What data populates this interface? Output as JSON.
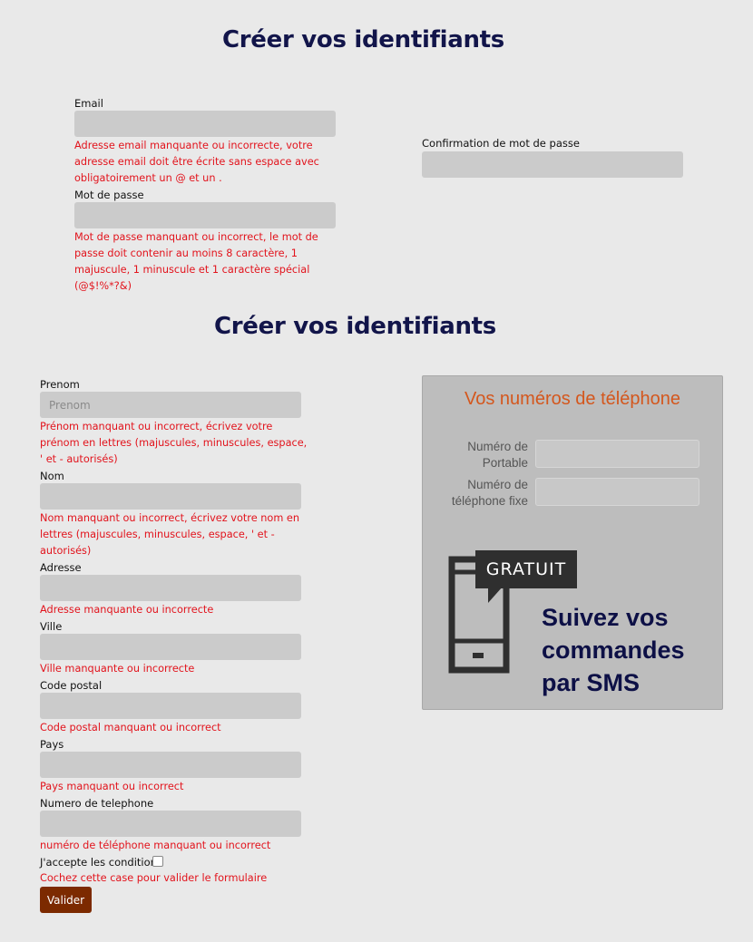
{
  "section1": {
    "title": "Créer vos identifiants",
    "email_label": "Email",
    "email_error": "Adresse email manquante ou incorrecte, votre adresse email doit être écrite sans espace avec obligatoirement un @ et un .",
    "password_label": "Mot de passe",
    "password_error": "Mot de passe manquant ou incorrect, le mot de passe doit contenir au moins 8 caractère, 1 majuscule, 1 minuscule et 1 caractère spécial (@$!%*?&)",
    "confirm_label": "Confirmation de mot de passe"
  },
  "section2": {
    "title": "Créer vos identifiants",
    "prenom_label": "Prenom",
    "prenom_placeholder": "Prenom",
    "prenom_error": "Prénom manquant ou incorrect, écrivez votre prénom en lettres (majuscules, minuscules, espace, ' et - autorisés)",
    "nom_label": "Nom",
    "nom_error": "Nom manquant ou incorrect, écrivez votre nom en lettres (majuscules, minuscules, espace, ' et - autorisés)",
    "adresse_label": "Adresse",
    "adresse_error": "Adresse manquante ou incorrecte",
    "ville_label": "Ville",
    "ville_error": "Ville manquante ou incorrecte",
    "cp_label": "Code postal",
    "cp_error": "Code postal manquant ou incorrect",
    "pays_label": "Pays",
    "pays_error": "Pays manquant ou incorrect",
    "tel_label": "Numero de telephone",
    "tel_error": "numéro de téléphone manquant ou incorrect",
    "conditions_label": "J'accepte les conditions",
    "conditions_error": "Cochez cette case pour valider le formulaire",
    "submit_label": "Valider"
  },
  "phone_panel": {
    "title": "Vos numéros de téléphone",
    "mobile_label_1": "Numéro de",
    "mobile_label_2": "Portable",
    "fixed_label_1": "Numéro de",
    "fixed_label_2": "téléphone fixe",
    "badge": "GRATUIT",
    "promo_line1": "Suivez vos",
    "promo_line2": "commandes",
    "promo_line3": "par SMS",
    "icon": "mobile-phone-icon"
  },
  "colors": {
    "title": "#12154a",
    "error": "#e2131c",
    "button": "#7c2a00",
    "panel_title": "#d4571d"
  }
}
